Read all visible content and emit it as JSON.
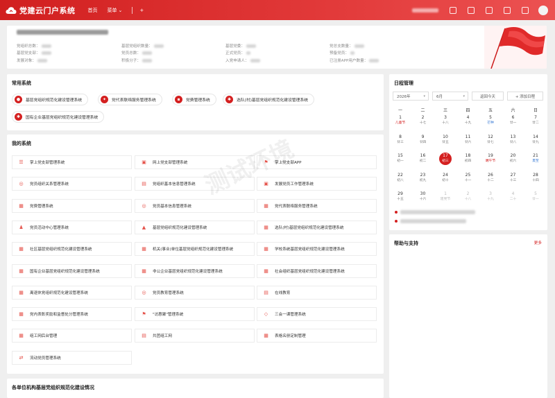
{
  "app": {
    "title": "党建云门户系统"
  },
  "nav": {
    "home": "首页",
    "menu": "菜单",
    "add": "+"
  },
  "stats": {
    "items": [
      {
        "label": "党组织总数："
      },
      {
        "label": "基层党组织数量："
      },
      {
        "label": "基层党委："
      },
      {
        "label": "党总支数量："
      },
      {
        "label": "基层党支部："
      },
      {
        "label": "党员总数："
      },
      {
        "label": "正式党员："
      },
      {
        "label": "预备党员："
      },
      {
        "label": "发展对象："
      },
      {
        "label": "积极分子："
      },
      {
        "label": "入党申请人："
      },
      {
        "label": "已注册APP用户数量："
      }
    ]
  },
  "common": {
    "title": "常用系统",
    "items": [
      {
        "label": "基层党组织规范化建设管理系统"
      },
      {
        "label": "党代表联络服务管理系统"
      },
      {
        "label": "党费管理系统"
      },
      {
        "label": "选队(村)基层党组织规范化建设管理系统"
      },
      {
        "label": "国有企业基层党组织规范化建设管理系统"
      }
    ]
  },
  "my": {
    "title": "我的系统",
    "items": [
      {
        "label": "掌上党支部管理系统",
        "icon": "☰"
      },
      {
        "label": "网上党支部管理系统",
        "icon": "▣"
      },
      {
        "label": "掌上党支部APP",
        "icon": "⚑"
      },
      {
        "label": "党员组织关系管理系统",
        "icon": "◎"
      },
      {
        "label": "党组织基本信息管理系统",
        "icon": "▤"
      },
      {
        "label": "发展党员工作管理系统",
        "icon": "▣"
      },
      {
        "label": "党费管理系统",
        "icon": "▦"
      },
      {
        "label": "党员基本信息管理系统",
        "icon": "◎"
      },
      {
        "label": "党代表联络服务管理系统",
        "icon": "▦"
      },
      {
        "label": "党员活动中心管理系统",
        "icon": "♟"
      },
      {
        "label": "基层党组织规范化建设管理系统",
        "icon": "▲"
      },
      {
        "label": "选队(村)基层党组织规范化建设管理系统",
        "icon": "▦"
      },
      {
        "label": "社区基层党组织规范化建设管理系统",
        "icon": "▦"
      },
      {
        "label": "机关(事业)单位基层党组织规范化建设管理系统",
        "icon": "▦"
      },
      {
        "label": "学校系统基层党组织规范化建设管理系统",
        "icon": "▦"
      },
      {
        "label": "国有企业基层党组织规范化建设管理系统",
        "icon": "▦"
      },
      {
        "label": "非公企业基层党组织规范化建设管理系统",
        "icon": "▦"
      },
      {
        "label": "社会组织基层党组织规范化建设管理系统",
        "icon": "▦"
      },
      {
        "label": "离退休党组织规范化建设管理系统",
        "icon": "▦"
      },
      {
        "label": "党员教育管理系统",
        "icon": "◎"
      },
      {
        "label": "在线教育",
        "icon": "▤"
      },
      {
        "label": "党内表彰奖励和监督处分管理系统",
        "icon": "▦"
      },
      {
        "label": "\"访惠聚\"管理系统",
        "icon": "⚑"
      },
      {
        "label": "三会一课管理系统",
        "icon": "◇"
      },
      {
        "label": "组工网后台管理",
        "icon": "▦"
      },
      {
        "label": "共团组工网",
        "icon": "▤"
      },
      {
        "label": "表格名册定制管理",
        "icon": "▦"
      },
      {
        "label": "流动党员管理系统",
        "icon": "⇄"
      }
    ]
  },
  "bottom": {
    "title": "各单位机构基层党组织规范化建设情况"
  },
  "schedule": {
    "title": "日程管理",
    "year": "2026年",
    "month": "6月",
    "back_today": "返回今天",
    "add": "+ 添加日程",
    "weekdays": [
      "一",
      "二",
      "三",
      "四",
      "五",
      "六",
      "日"
    ],
    "days": [
      {
        "n": "1",
        "l": "儿童节",
        "c": "red"
      },
      {
        "n": "2",
        "l": "十七"
      },
      {
        "n": "3",
        "l": "十八"
      },
      {
        "n": "4",
        "l": "十九"
      },
      {
        "n": "5",
        "l": "芒种",
        "c": "blue"
      },
      {
        "n": "6",
        "l": "廿一"
      },
      {
        "n": "7",
        "l": "廿二"
      },
      {
        "n": "8",
        "l": "廿三"
      },
      {
        "n": "9",
        "l": "廿四"
      },
      {
        "n": "10",
        "l": "廿五"
      },
      {
        "n": "11",
        "l": "廿六"
      },
      {
        "n": "12",
        "l": "廿七"
      },
      {
        "n": "13",
        "l": "廿八"
      },
      {
        "n": "14",
        "l": "廿九"
      },
      {
        "n": "15",
        "l": "初一"
      },
      {
        "n": "16",
        "l": "初二"
      },
      {
        "n": "17",
        "l": "初三",
        "today": true
      },
      {
        "n": "18",
        "l": "初四"
      },
      {
        "n": "19",
        "l": "端午节",
        "c": "red"
      },
      {
        "n": "20",
        "l": "初六"
      },
      {
        "n": "21",
        "l": "夏至",
        "c": "blue"
      },
      {
        "n": "22",
        "l": "初八"
      },
      {
        "n": "23",
        "l": "初九"
      },
      {
        "n": "24",
        "l": "初十"
      },
      {
        "n": "25",
        "l": "十一"
      },
      {
        "n": "26",
        "l": "十二"
      },
      {
        "n": "27",
        "l": "十三"
      },
      {
        "n": "28",
        "l": "十四"
      },
      {
        "n": "29",
        "l": "十五"
      },
      {
        "n": "30",
        "l": "十六"
      },
      {
        "n": "1",
        "l": "建党节",
        "faded": true
      },
      {
        "n": "2",
        "l": "十八",
        "faded": true
      },
      {
        "n": "3",
        "l": "十九",
        "faded": true
      },
      {
        "n": "4",
        "l": "二十",
        "faded": true
      },
      {
        "n": "5",
        "l": "廿一",
        "faded": true
      }
    ]
  },
  "help": {
    "title": "帮助与支持",
    "more": "更多"
  },
  "watermark": "测试环境",
  "colors": {
    "primary": "#d42020"
  }
}
